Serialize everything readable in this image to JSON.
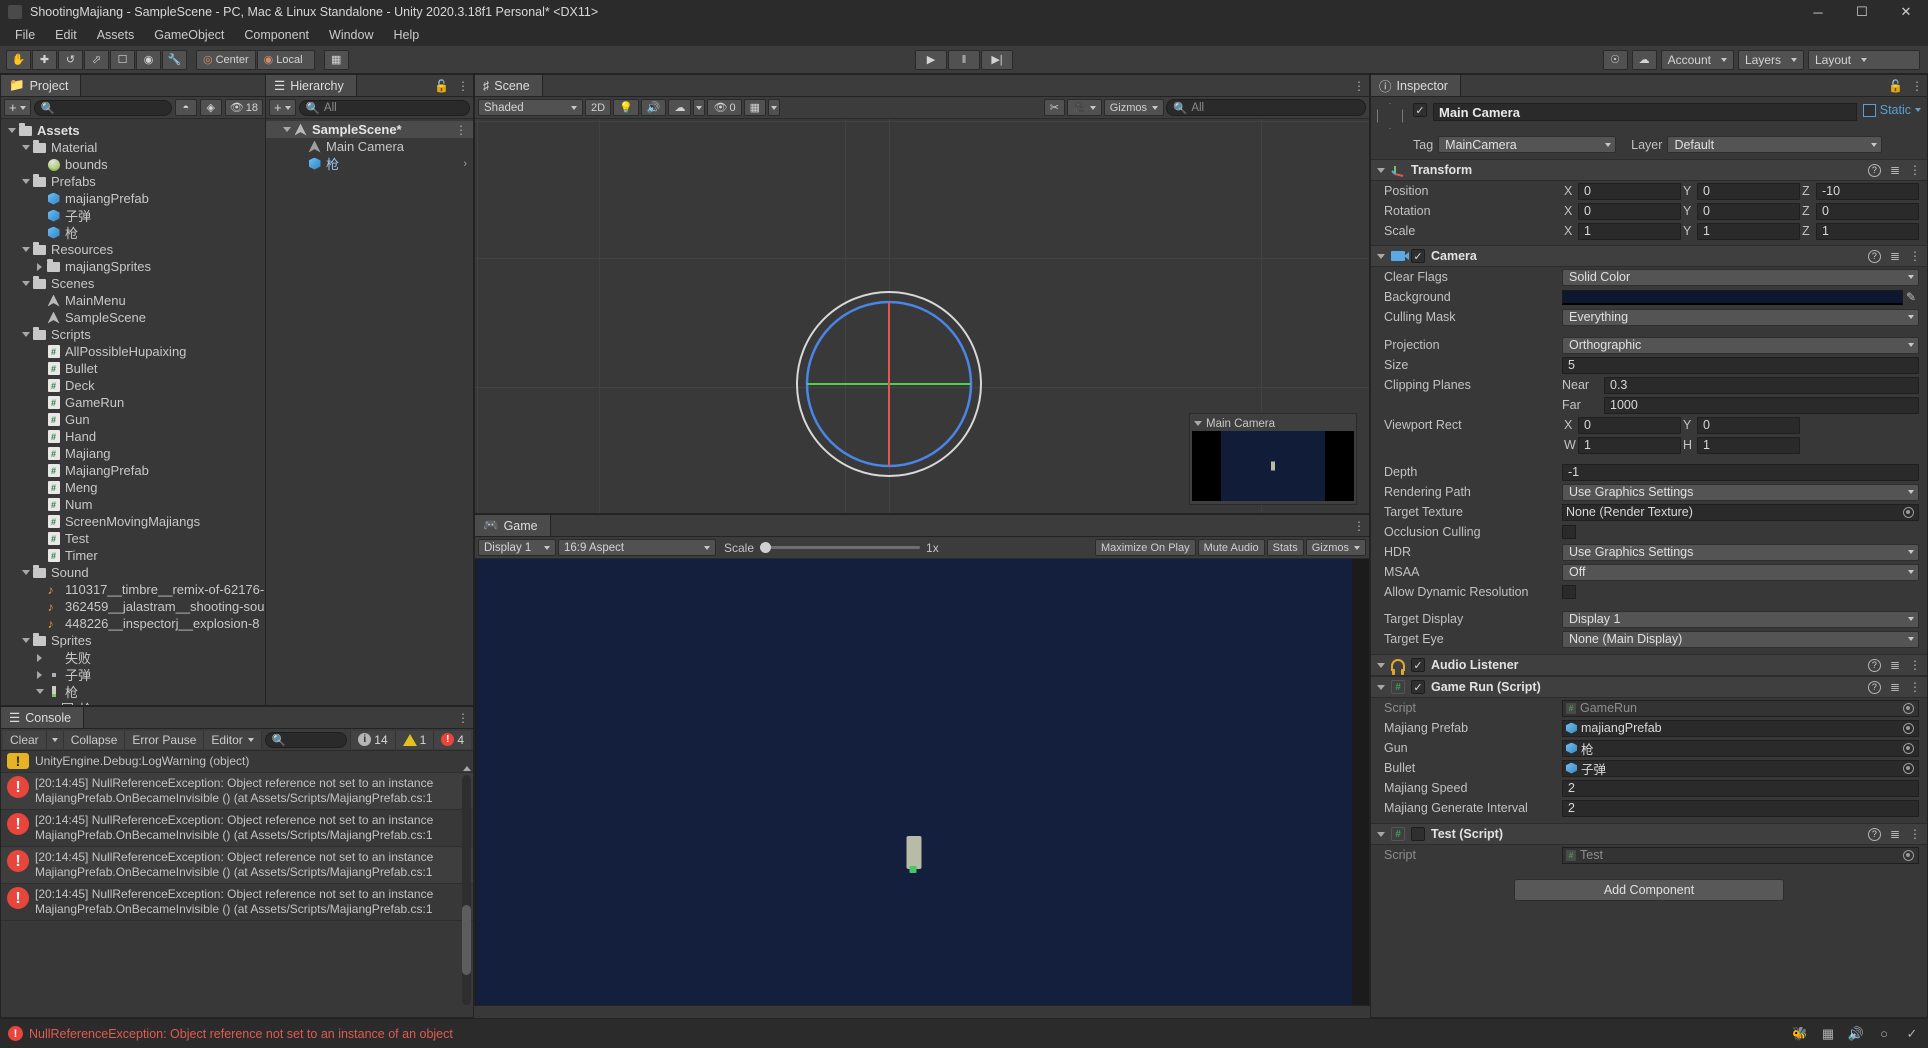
{
  "window": {
    "title": "ShootingMajiang - SampleScene - PC, Mac & Linux Standalone - Unity 2020.3.18f1 Personal* <DX11>",
    "minimize": "─",
    "maximize": "☐",
    "close": "✕"
  },
  "menu": [
    "File",
    "Edit",
    "Assets",
    "GameObject",
    "Component",
    "Window",
    "Help"
  ],
  "toolbar": {
    "tools": [
      "hand-tool",
      "move-tool",
      "rotate-tool",
      "scale-tool",
      "rect-tool",
      "transform-tool",
      "custom-tool"
    ],
    "pivot_mode": "Center",
    "pivot_rotation": "Local",
    "grid_snap": "grid-snap-icon",
    "play": "▶",
    "pause": "‖",
    "step": "▶|",
    "collab": "cloud-icon",
    "services": "services-icon",
    "account": "Account",
    "layers": "Layers",
    "layout": "Layout"
  },
  "project": {
    "tab": "Project",
    "search_placeholder": "",
    "hidden_count": "18",
    "tree": [
      {
        "depth": 0,
        "label": "Assets",
        "icon": "folder",
        "arrow": "down",
        "bold": true
      },
      {
        "depth": 1,
        "label": "Material",
        "icon": "folder",
        "arrow": "down"
      },
      {
        "depth": 2,
        "label": "bounds",
        "icon": "material",
        "arrow": "none"
      },
      {
        "depth": 1,
        "label": "Prefabs",
        "icon": "folder",
        "arrow": "down"
      },
      {
        "depth": 2,
        "label": "majiangPrefab",
        "icon": "prefab",
        "arrow": "none"
      },
      {
        "depth": 2,
        "label": "子弹",
        "icon": "prefab",
        "arrow": "none"
      },
      {
        "depth": 2,
        "label": "枪",
        "icon": "prefab",
        "arrow": "none"
      },
      {
        "depth": 1,
        "label": "Resources",
        "icon": "folder",
        "arrow": "down"
      },
      {
        "depth": 2,
        "label": "majiangSprites",
        "icon": "folder",
        "arrow": "right"
      },
      {
        "depth": 1,
        "label": "Scenes",
        "icon": "folder",
        "arrow": "down"
      },
      {
        "depth": 2,
        "label": "MainMenu",
        "icon": "scene",
        "arrow": "none"
      },
      {
        "depth": 2,
        "label": "SampleScene",
        "icon": "scene",
        "arrow": "none"
      },
      {
        "depth": 1,
        "label": "Scripts",
        "icon": "folder",
        "arrow": "down"
      },
      {
        "depth": 2,
        "label": "AllPossibleHupaixing",
        "icon": "cs",
        "arrow": "none"
      },
      {
        "depth": 2,
        "label": "Bullet",
        "icon": "cs",
        "arrow": "none"
      },
      {
        "depth": 2,
        "label": "Deck",
        "icon": "cs",
        "arrow": "none"
      },
      {
        "depth": 2,
        "label": "GameRun",
        "icon": "cs",
        "arrow": "none"
      },
      {
        "depth": 2,
        "label": "Gun",
        "icon": "cs",
        "arrow": "none"
      },
      {
        "depth": 2,
        "label": "Hand",
        "icon": "cs",
        "arrow": "none"
      },
      {
        "depth": 2,
        "label": "Majiang",
        "icon": "cs",
        "arrow": "none"
      },
      {
        "depth": 2,
        "label": "MajiangPrefab",
        "icon": "cs",
        "arrow": "none"
      },
      {
        "depth": 2,
        "label": "Meng",
        "icon": "cs",
        "arrow": "none"
      },
      {
        "depth": 2,
        "label": "Num",
        "icon": "cs",
        "arrow": "none"
      },
      {
        "depth": 2,
        "label": "ScreenMovingMajiangs",
        "icon": "cs",
        "arrow": "none"
      },
      {
        "depth": 2,
        "label": "Test",
        "icon": "cs",
        "arrow": "none"
      },
      {
        "depth": 2,
        "label": "Timer",
        "icon": "cs",
        "arrow": "none"
      },
      {
        "depth": 1,
        "label": "Sound",
        "icon": "folder",
        "arrow": "down"
      },
      {
        "depth": 2,
        "label": "110317__timbre__remix-of-62176-",
        "icon": "audio",
        "arrow": "none"
      },
      {
        "depth": 2,
        "label": "362459__jalastram__shooting-sou",
        "icon": "audio",
        "arrow": "none"
      },
      {
        "depth": 2,
        "label": "448226__inspectorj__explosion-8",
        "icon": "audio",
        "arrow": "none"
      },
      {
        "depth": 1,
        "label": "Sprites",
        "icon": "folder",
        "arrow": "down"
      },
      {
        "depth": 2,
        "label": "失败",
        "icon": "none",
        "arrow": "right"
      },
      {
        "depth": 2,
        "label": "子弹",
        "icon": "dot",
        "arrow": "right"
      },
      {
        "depth": 2,
        "label": "枪",
        "icon": "gunsprite",
        "arrow": "down"
      },
      {
        "depth": 3,
        "label": "枪",
        "icon": "sprite",
        "arrow": "none"
      }
    ]
  },
  "hierarchy": {
    "tab": "Hierarchy",
    "search_placeholder": "All",
    "items": [
      {
        "depth": 1,
        "label": "SampleScene*",
        "icon": "scene",
        "arrow": "down",
        "selected": true,
        "more": "⋮"
      },
      {
        "depth": 2,
        "label": "Main Camera",
        "icon": "gameobject",
        "arrow": "none"
      },
      {
        "depth": 2,
        "label": "枪",
        "icon": "prefab",
        "arrow": "none",
        "chev": "›",
        "blue": true
      }
    ]
  },
  "scene": {
    "tab": "Scene",
    "shading": "Shaded",
    "mode_2d": "2D",
    "lighting": "lighting-icon",
    "audio": "audio-icon",
    "fx": "fx-icon",
    "hidden_objects": "0",
    "grid": "grid-icon",
    "gizmos": "Gizmos",
    "search_placeholder": "All",
    "camera_preview_title": "Main Camera"
  },
  "game": {
    "tab": "Game",
    "display": "Display 1",
    "aspect": "16:9 Aspect",
    "scale_label": "Scale",
    "scale_value": "1x",
    "maximize": "Maximize On Play",
    "mute": "Mute Audio",
    "stats": "Stats",
    "gizmos": "Gizmos"
  },
  "console": {
    "tab": "Console",
    "clear": "Clear",
    "collapse": "Collapse",
    "error_pause": "Error Pause",
    "editor": "Editor",
    "search_placeholder": "",
    "info_count": "14",
    "warn_count": "1",
    "error_count": "4",
    "rows": [
      {
        "type": "warn",
        "line1": "UnityEngine.Debug:LogWarning (object)",
        "line2": ""
      },
      {
        "type": "error",
        "line1": "[20:14:45] NullReferenceException: Object reference not set to an instance",
        "line2": "MajiangPrefab.OnBecameInvisible () (at Assets/Scripts/MajiangPrefab.cs:1"
      },
      {
        "type": "error",
        "line1": "[20:14:45] NullReferenceException: Object reference not set to an instance",
        "line2": "MajiangPrefab.OnBecameInvisible () (at Assets/Scripts/MajiangPrefab.cs:1"
      },
      {
        "type": "error",
        "line1": "[20:14:45] NullReferenceException: Object reference not set to an instance",
        "line2": "MajiangPrefab.OnBecameInvisible () (at Assets/Scripts/MajiangPrefab.cs:1"
      },
      {
        "type": "error",
        "line1": "[20:14:45] NullReferenceException: Object reference not set to an instance",
        "line2": "MajiangPrefab.OnBecameInvisible () (at Assets/Scripts/MajiangPrefab.cs:1"
      }
    ]
  },
  "inspector": {
    "tab": "Inspector",
    "object_name": "Main Camera",
    "static_label": "Static",
    "tag_label": "Tag",
    "tag_value": "MainCamera",
    "layer_label": "Layer",
    "layer_value": "Default",
    "transform": {
      "title": "Transform",
      "position": {
        "label": "Position",
        "x": "0",
        "y": "0",
        "z": "-10"
      },
      "rotation": {
        "label": "Rotation",
        "x": "0",
        "y": "0",
        "z": "0"
      },
      "scale": {
        "label": "Scale",
        "x": "1",
        "y": "1",
        "z": "1"
      }
    },
    "camera": {
      "title": "Camera",
      "clear_flags_label": "Clear Flags",
      "clear_flags": "Solid Color",
      "background_label": "Background",
      "background_color": "#0d1830",
      "culling_mask_label": "Culling Mask",
      "culling_mask": "Everything",
      "projection_label": "Projection",
      "projection": "Orthographic",
      "size_label": "Size",
      "size": "5",
      "clipping_label": "Clipping Planes",
      "near_label": "Near",
      "near": "0.3",
      "far_label": "Far",
      "far": "1000",
      "viewport_label": "Viewport Rect",
      "vp_x": "0",
      "vp_y": "0",
      "vp_w": "1",
      "vp_h": "1",
      "depth_label": "Depth",
      "depth": "-1",
      "rendering_path_label": "Rendering Path",
      "rendering_path": "Use Graphics Settings",
      "target_texture_label": "Target Texture",
      "target_texture": "None (Render Texture)",
      "occlusion_label": "Occlusion Culling",
      "hdr_label": "HDR",
      "hdr": "Use Graphics Settings",
      "msaa_label": "MSAA",
      "msaa": "Off",
      "dynamic_res_label": "Allow Dynamic Resolution",
      "target_display_label": "Target Display",
      "target_display": "Display 1",
      "target_eye_label": "Target Eye",
      "target_eye": "None (Main Display)"
    },
    "audio_listener": {
      "title": "Audio Listener"
    },
    "game_run": {
      "title": "Game Run (Script)",
      "script_label": "Script",
      "script_value": "GameRun",
      "majiang_prefab_label": "Majiang Prefab",
      "majiang_prefab_value": "majiangPrefab",
      "gun_label": "Gun",
      "gun_value": "枪",
      "bullet_label": "Bullet",
      "bullet_value": "子弹",
      "speed_label": "Majiang Speed",
      "speed_value": "2",
      "interval_label": "Majiang Generate Interval",
      "interval_value": "2"
    },
    "test": {
      "title": "Test (Script)",
      "script_label": "Script",
      "script_value": "Test"
    },
    "add_component": "Add Component"
  },
  "statusbar": {
    "message": "NullReferenceException: Object reference not set to an instance of an object",
    "icons": [
      "bug-icon",
      "profiler-icon",
      "mute-icon",
      "progress-icon",
      "check-icon"
    ]
  }
}
